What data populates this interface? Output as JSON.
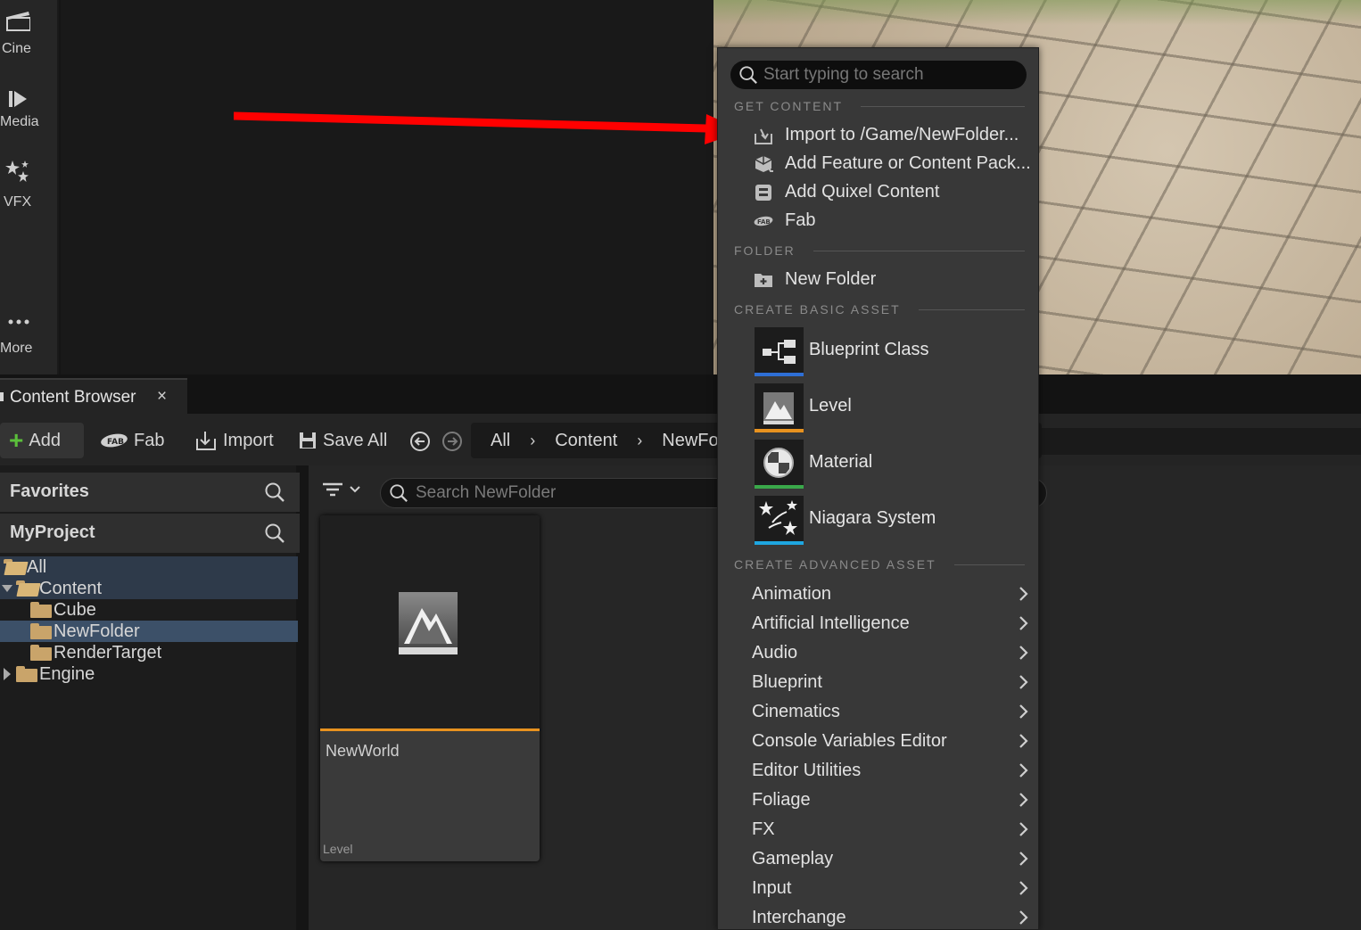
{
  "toolbar_left": {
    "items": [
      {
        "label": "Cine",
        "icon": "clapperboard-icon"
      },
      {
        "label": "Media",
        "icon": "media-play-icon"
      },
      {
        "label": "VFX",
        "icon": "sparkle-stars-icon"
      },
      {
        "label": "More",
        "icon": "ellipsis-icon"
      }
    ]
  },
  "content_browser": {
    "tab_title": "Content Browser",
    "tab_close": "×",
    "toolbar": {
      "add_label": "Add",
      "fab_label": "Fab",
      "import_label": "Import",
      "save_all_label": "Save All"
    },
    "breadcrumb": [
      "All",
      "Content",
      "NewFolder"
    ],
    "breadcrumb_sep": "›",
    "favorites_label": "Favorites",
    "project_label": "MyProject",
    "tree": [
      {
        "label": "All",
        "depth": 0,
        "expanded": true
      },
      {
        "label": "Content",
        "depth": 1,
        "expanded": true
      },
      {
        "label": "Cube",
        "depth": 2
      },
      {
        "label": "NewFolder",
        "depth": 2,
        "selected": true
      },
      {
        "label": "RenderTarget",
        "depth": 2
      },
      {
        "label": "Engine",
        "depth": 1,
        "expanded": false
      }
    ],
    "search_placeholder": "Search NewFolder",
    "asset": {
      "name": "NewWorld",
      "type": "Level",
      "accent": "#e8921f"
    }
  },
  "add_menu": {
    "search_placeholder": "Start typing to search",
    "sections": {
      "get_content": "GET CONTENT",
      "folder": "FOLDER",
      "create_basic": "CREATE BASIC ASSET",
      "create_advanced": "CREATE ADVANCED ASSET"
    },
    "get_content_items": [
      {
        "label": "Import to /Game/NewFolder...",
        "icon": "import-icon"
      },
      {
        "label": "Add Feature or Content Pack...",
        "icon": "feature-pack-icon"
      },
      {
        "label": "Add Quixel Content",
        "icon": "quixel-icon"
      },
      {
        "label": "Fab",
        "icon": "fab-icon"
      }
    ],
    "folder_items": [
      {
        "label": "New Folder",
        "icon": "new-folder-icon"
      }
    ],
    "basic_assets": [
      {
        "label": "Blueprint Class",
        "icon": "blueprint-class-icon",
        "color": "#2e6fd6"
      },
      {
        "label": "Level",
        "icon": "level-icon",
        "color": "#e8921f"
      },
      {
        "label": "Material",
        "icon": "material-icon",
        "color": "#3aa84a"
      },
      {
        "label": "Niagara System",
        "icon": "niagara-icon",
        "color": "#1fa6e0"
      }
    ],
    "advanced_assets": [
      "Animation",
      "Artificial Intelligence",
      "Audio",
      "Blueprint",
      "Cinematics",
      "Console Variables Editor",
      "Editor Utilities",
      "Foliage",
      "FX",
      "Gameplay",
      "Input",
      "Interchange"
    ]
  },
  "annotation": {
    "color": "#ff0000",
    "icon": "red-arrow-icon"
  }
}
